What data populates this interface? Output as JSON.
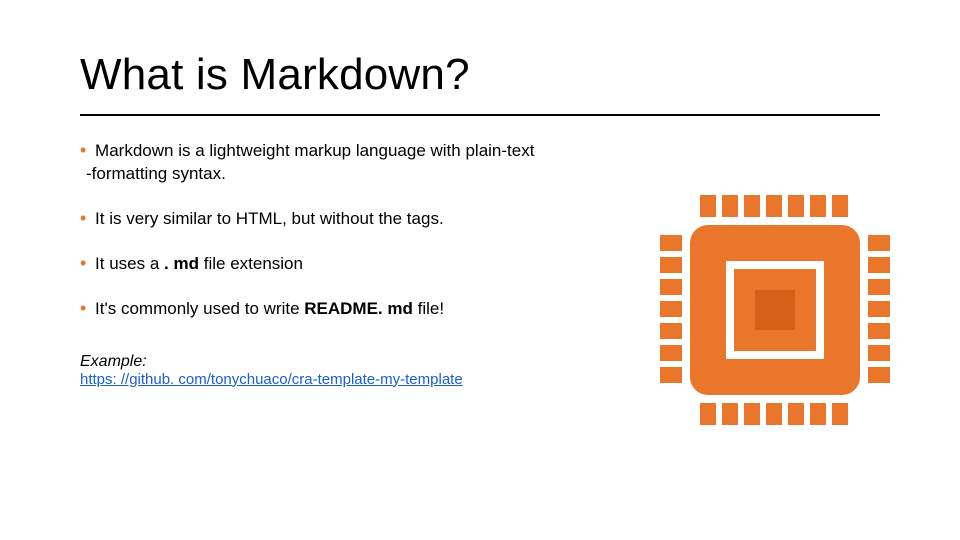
{
  "title": "What is Markdown?",
  "bullets": {
    "b1a": "Markdown is a lightweight markup language with plain-text",
    "b1b": "-formatting syntax.",
    "b2": "It is very similar to HTML, but without the tags.",
    "b3_pre": "It uses a",
    "b3_bold": ". md",
    "b3_post": " file extension",
    "b4_pre": "It's commonly used to write ",
    "b4_bold": "README. md",
    "b4_post": " file!"
  },
  "example": {
    "label": "Example:",
    "url": "https: //github. com/tonychuaco/cra-template-my-template"
  },
  "colors": {
    "accent": "#e9762b"
  }
}
